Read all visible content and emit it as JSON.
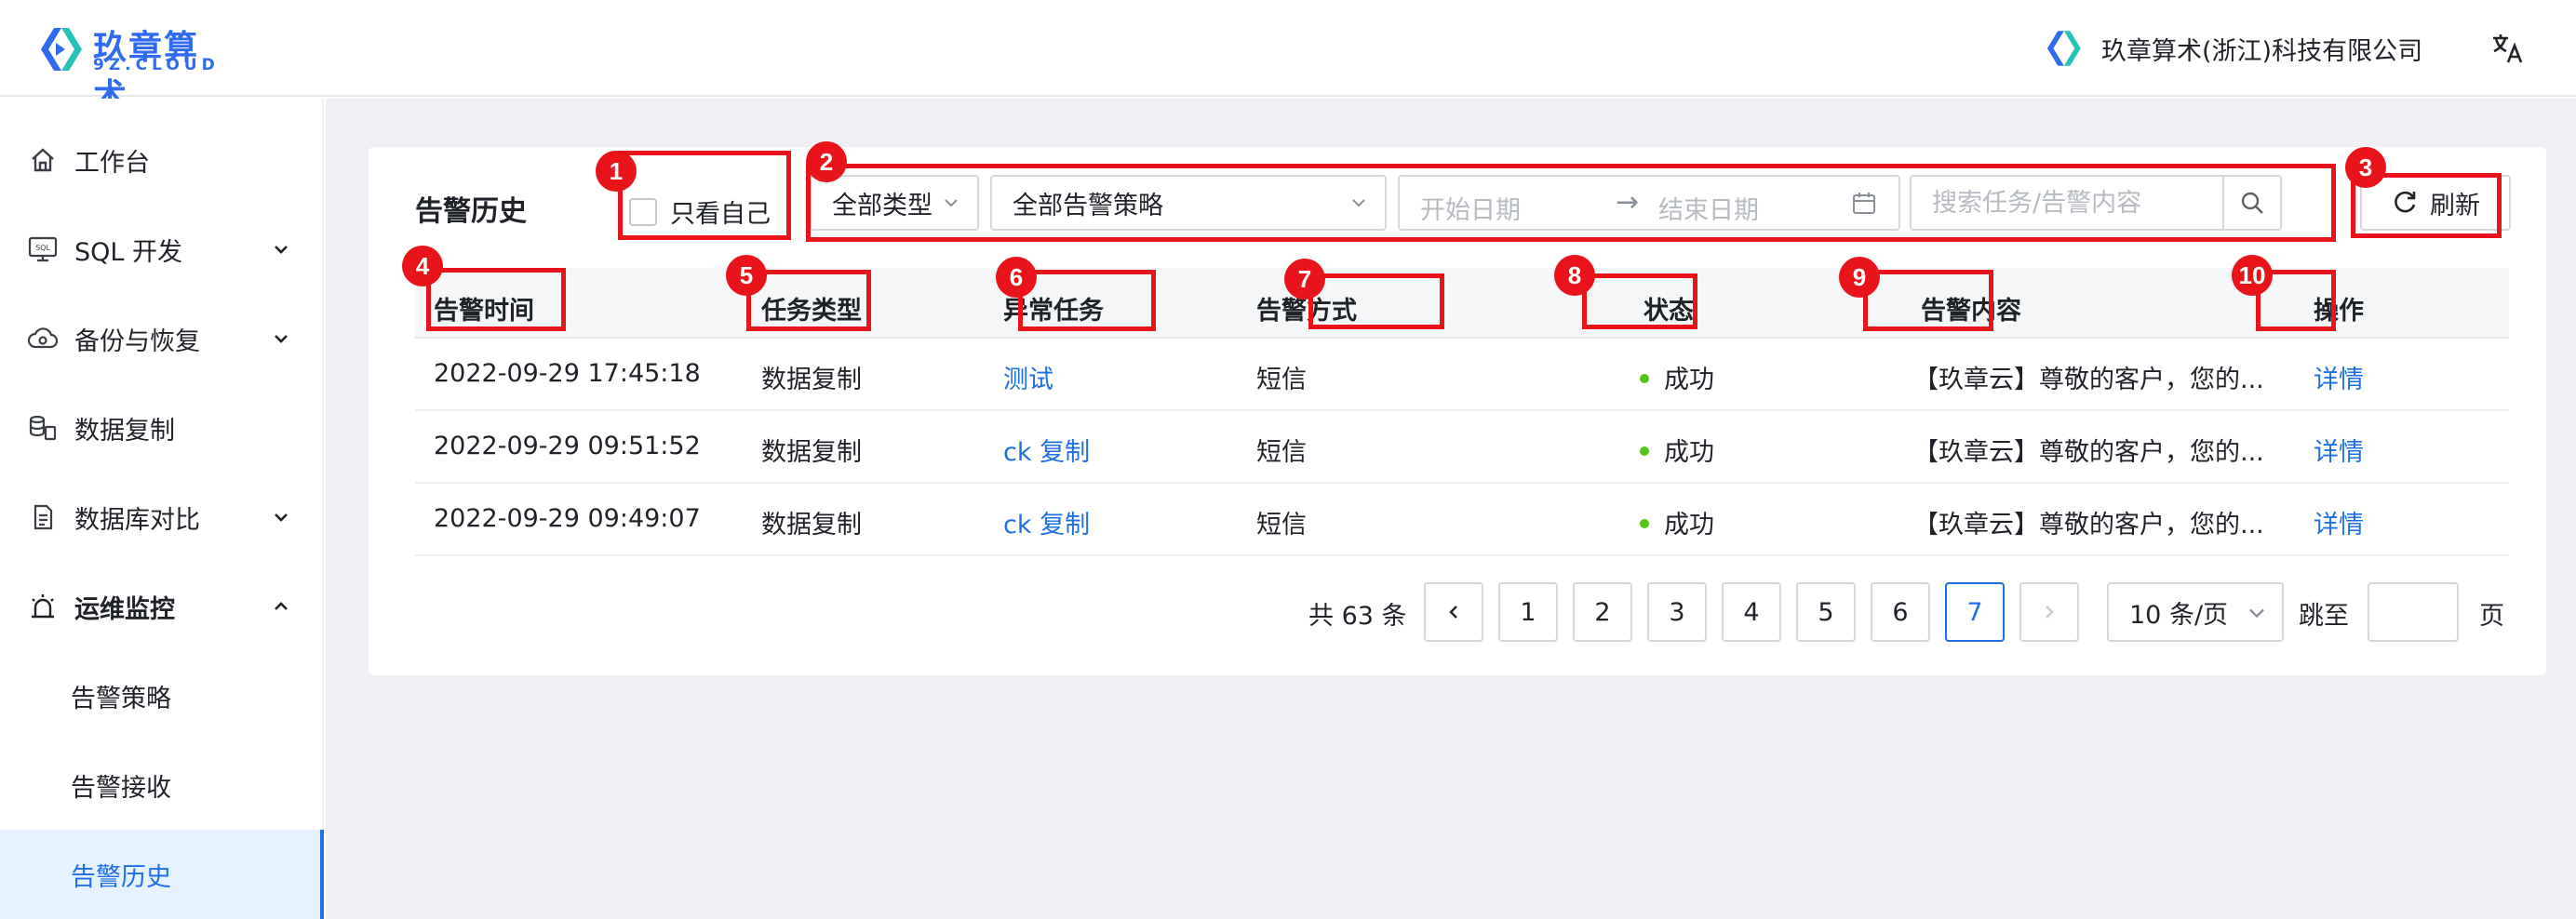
{
  "header": {
    "logo_text": "玖章算术",
    "logo_sub": "9Z.CLOUD",
    "company": "玖章算术(浙江)科技有限公司"
  },
  "sidebar": {
    "items": [
      {
        "label": "工作台",
        "icon": "home-icon"
      },
      {
        "label": "SQL 开发",
        "icon": "sql-icon"
      },
      {
        "label": "备份与恢复",
        "icon": "cloud-backup-icon"
      },
      {
        "label": "数据复制",
        "icon": "data-copy-icon"
      },
      {
        "label": "数据库对比",
        "icon": "db-compare-icon"
      },
      {
        "label": "运维监控",
        "icon": "alarm-icon"
      },
      {
        "label": "告警策略"
      },
      {
        "label": "告警接收"
      },
      {
        "label": "告警历史"
      }
    ]
  },
  "page": {
    "title": "告警历史",
    "only_mine": "只看自己",
    "type_filter": "全部类型",
    "policy_filter": "全部告警策略",
    "date_start_placeholder": "开始日期",
    "date_end_placeholder": "结束日期",
    "search_placeholder": "搜索任务/告警内容",
    "refresh": "刷新"
  },
  "table": {
    "columns": [
      "告警时间",
      "任务类型",
      "异常任务",
      "告警方式",
      "状态",
      "告警内容",
      "操作"
    ],
    "rows": [
      {
        "time": "2022-09-29 17:45:18",
        "type": "数据复制",
        "task": "测试",
        "method": "短信",
        "status": "成功",
        "content": "【玖章云】尊敬的客户，您的...",
        "action": "详情"
      },
      {
        "time": "2022-09-29 09:51:52",
        "type": "数据复制",
        "task": "ck 复制",
        "method": "短信",
        "status": "成功",
        "content": "【玖章云】尊敬的客户，您的...",
        "action": "详情"
      },
      {
        "time": "2022-09-29 09:49:07",
        "type": "数据复制",
        "task": "ck 复制",
        "method": "短信",
        "status": "成功",
        "content": "【玖章云】尊敬的客户，您的...",
        "action": "详情"
      }
    ]
  },
  "pagination": {
    "total": "共 63 条",
    "pages": [
      "1",
      "2",
      "3",
      "4",
      "5",
      "6",
      "7"
    ],
    "current": "7",
    "page_size": "10 条/页",
    "jump_label": "跳至",
    "jump_suffix": "页"
  },
  "annotations": [
    "1",
    "2",
    "3",
    "4",
    "5",
    "6",
    "7",
    "8",
    "9",
    "10"
  ],
  "colors": {
    "accent": "#1f6fe6",
    "annotation": "#e8141a",
    "success": "#52c41a",
    "logo": "#2f6bf0"
  }
}
